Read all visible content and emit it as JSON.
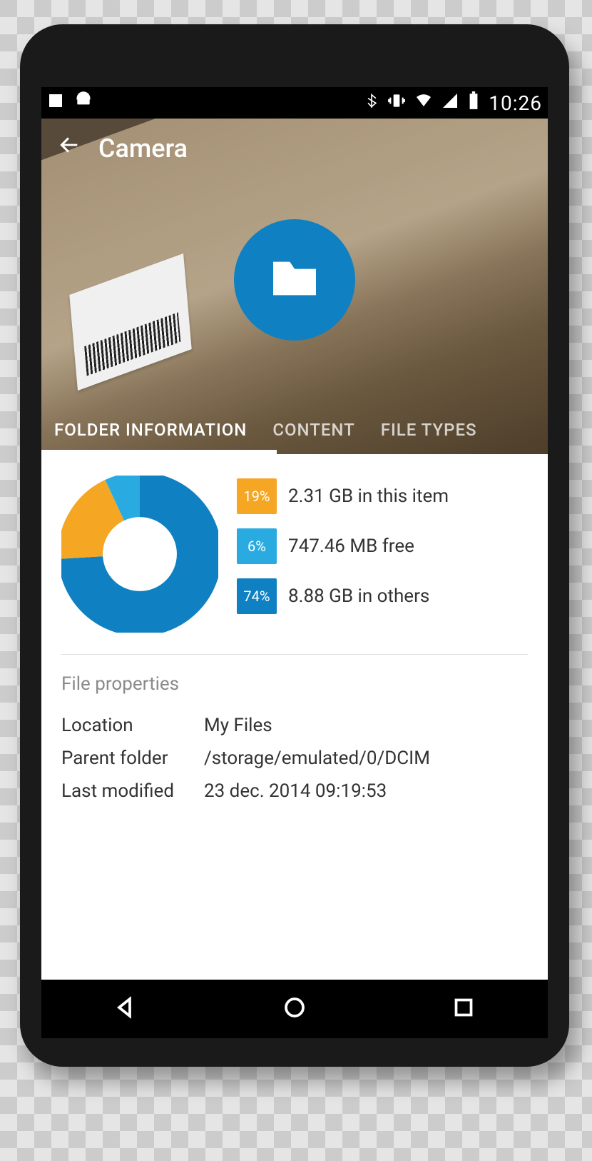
{
  "status": {
    "time": "10:26"
  },
  "header": {
    "title": "Camera"
  },
  "tabs": [
    {
      "label": "FOLDER INFORMATION",
      "active": true
    },
    {
      "label": "CONTENT",
      "active": false
    },
    {
      "label": "FILE TYPES",
      "active": false
    }
  ],
  "chart_data": {
    "type": "pie",
    "title": "",
    "series": [
      {
        "name": "in this item",
        "percent": 19,
        "color": "#f5a623"
      },
      {
        "name": "free",
        "percent": 6,
        "color": "#29abe2"
      },
      {
        "name": "in others",
        "percent": 74,
        "color": "#0f80c1"
      }
    ]
  },
  "storage": {
    "item": {
      "pct": "19%",
      "label": "2.31 GB in this item"
    },
    "free": {
      "pct": "6%",
      "label": "747.46 MB free"
    },
    "others": {
      "pct": "74%",
      "label": "8.88 GB in others"
    }
  },
  "properties": {
    "heading": "File properties",
    "location_key": "Location",
    "location_val": "My Files",
    "parent_key": "Parent folder",
    "parent_val": "/storage/emulated/0/DCIM",
    "modified_key": "Last modified",
    "modified_val": "23 dec. 2014 09:19:53"
  }
}
